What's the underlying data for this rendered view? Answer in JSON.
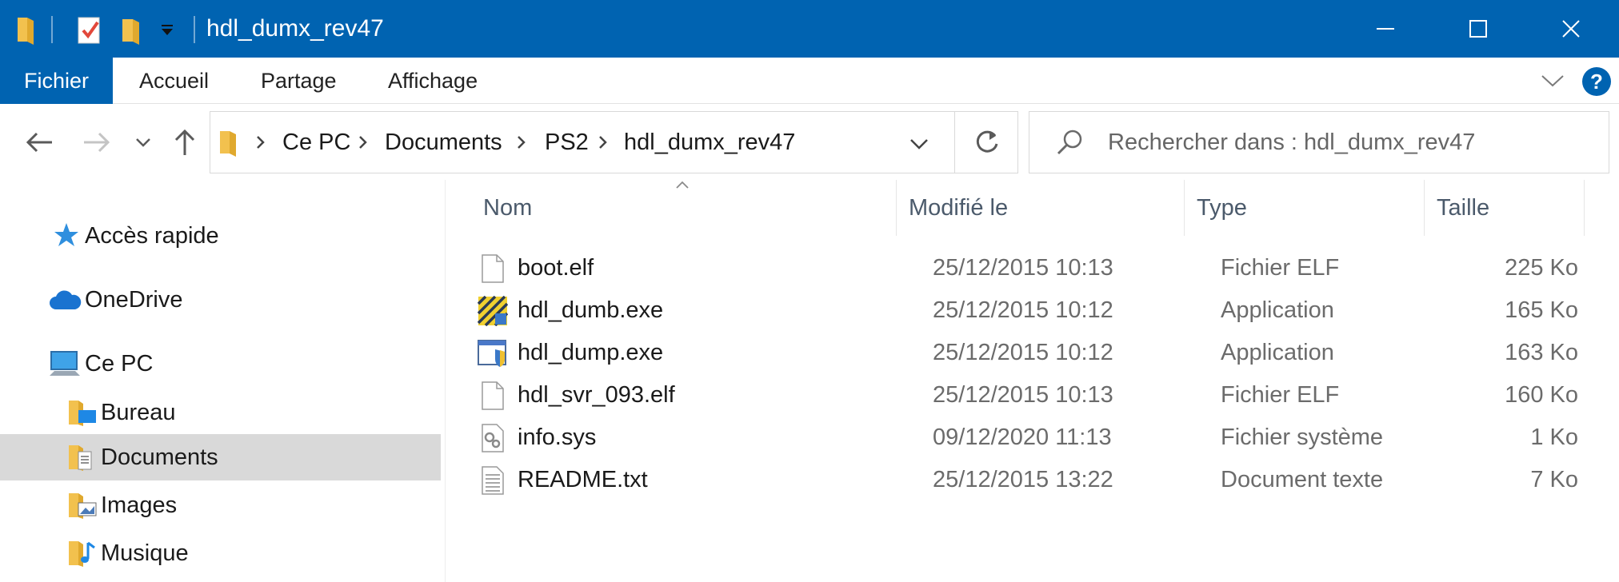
{
  "window": {
    "title": "hdl_dumx_rev47",
    "titlebar_color": "#0063b1"
  },
  "ribbon": {
    "file_tab": "Fichier",
    "tabs": [
      "Accueil",
      "Partage",
      "Affichage"
    ],
    "help_label": "?"
  },
  "address": {
    "crumbs": [
      "Ce PC",
      "Documents",
      "PS2",
      "hdl_dumx_rev47"
    ]
  },
  "search": {
    "placeholder": "Rechercher dans : hdl_dumx_rev47"
  },
  "nav_pane": {
    "items": [
      {
        "label": "Accès rapide",
        "icon": "star-icon"
      },
      {
        "label": "OneDrive",
        "icon": "cloud-icon"
      },
      {
        "label": "Ce PC",
        "icon": "computer-icon"
      },
      {
        "label": "Bureau",
        "icon": "desktop-folder-icon"
      },
      {
        "label": "Documents",
        "icon": "documents-folder-icon",
        "selected": true
      },
      {
        "label": "Images",
        "icon": "pictures-folder-icon"
      },
      {
        "label": "Musique",
        "icon": "music-folder-icon"
      }
    ]
  },
  "file_list": {
    "columns": {
      "name": "Nom",
      "modified": "Modifié le",
      "type": "Type",
      "size": "Taille"
    },
    "rows": [
      {
        "name": "boot.elf",
        "modified": "25/12/2015 10:13",
        "type": "Fichier ELF",
        "size": "225 Ko",
        "icon": "blank-file-icon"
      },
      {
        "name": "hdl_dumb.exe",
        "modified": "25/12/2015 10:12",
        "type": "Application",
        "size": "165 Ko",
        "icon": "app-exe-icon"
      },
      {
        "name": "hdl_dump.exe",
        "modified": "25/12/2015 10:12",
        "type": "Application",
        "size": "163 Ko",
        "icon": "shield-exe-icon"
      },
      {
        "name": "hdl_svr_093.elf",
        "modified": "25/12/2015 10:13",
        "type": "Fichier ELF",
        "size": "160 Ko",
        "icon": "blank-file-icon"
      },
      {
        "name": "info.sys",
        "modified": "09/12/2020 11:13",
        "type": "Fichier système",
        "size": "1 Ko",
        "icon": "system-file-icon"
      },
      {
        "name": "README.txt",
        "modified": "25/12/2015 13:22",
        "type": "Document texte",
        "size": "7 Ko",
        "icon": "text-file-icon"
      }
    ]
  }
}
